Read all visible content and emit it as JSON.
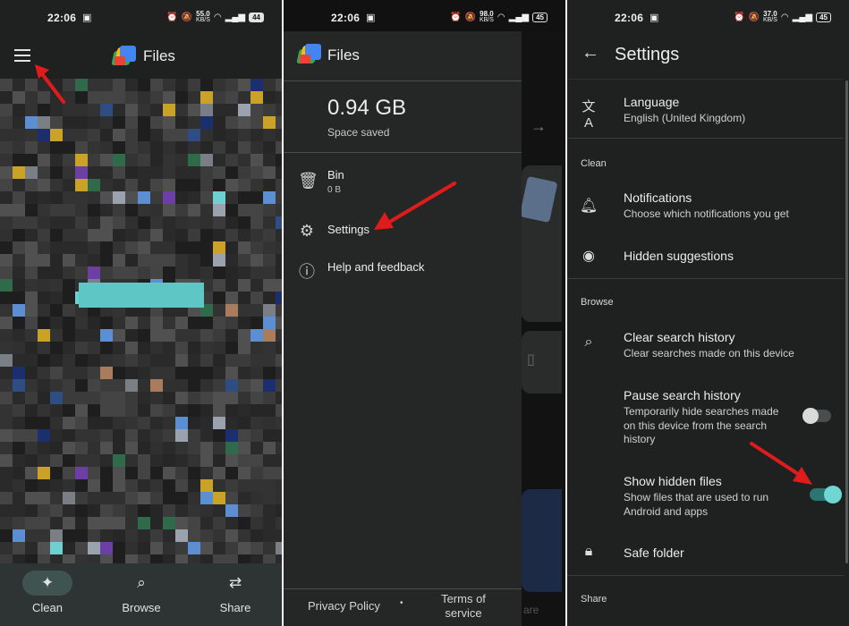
{
  "status": {
    "time": "22:06",
    "panel1": {
      "speed_top": "55.0",
      "speed_unit": "KB/S",
      "battery": "44"
    },
    "panel2": {
      "speed_top": "98.0",
      "speed_unit": "KB/S",
      "battery": "45"
    },
    "panel3": {
      "speed_top": "37.0",
      "speed_unit": "KB/S",
      "battery": "45"
    }
  },
  "files_home": {
    "app_title": "Files",
    "nav": [
      {
        "label": "Clean",
        "icon": "sparkle-icon"
      },
      {
        "label": "Browse",
        "icon": "browse-icon"
      },
      {
        "label": "Share",
        "icon": "share-icon"
      }
    ]
  },
  "drawer": {
    "app_title": "Files",
    "storage_value": "0.94 GB",
    "storage_label": "Space saved",
    "bin_label": "Bin",
    "bin_size": "0 B",
    "settings_label": "Settings",
    "help_label": "Help and feedback",
    "privacy_label": "Privacy Policy",
    "terms_line1": "Terms of",
    "terms_line2": "service",
    "footer_dot": "•",
    "behind_share": "are"
  },
  "settings": {
    "title": "Settings",
    "language_title": "Language",
    "language_value": "English (United Kingdom)",
    "section_clean": "Clean",
    "notifications_title": "Notifications",
    "notifications_desc": "Choose which notifications you get",
    "hidden_suggestions_title": "Hidden suggestions",
    "section_browse": "Browse",
    "clear_history_title": "Clear search history",
    "clear_history_desc": "Clear searches made on this device",
    "pause_history_title": "Pause search history",
    "pause_history_desc_1": "Temporarily hide searches made",
    "pause_history_desc_2": "on this device from the search",
    "pause_history_desc_3": "history",
    "pause_history_enabled": false,
    "show_hidden_title": "Show hidden files",
    "show_hidden_desc_1": "Show files that are used to run",
    "show_hidden_desc_2": "Android and apps",
    "show_hidden_enabled": true,
    "safe_folder_title": "Safe folder",
    "section_share": "Share"
  },
  "colors": {
    "accent_teal": "#6ed6d3",
    "annotation_red": "#e01b1b",
    "nav_active": "#3f5350"
  }
}
